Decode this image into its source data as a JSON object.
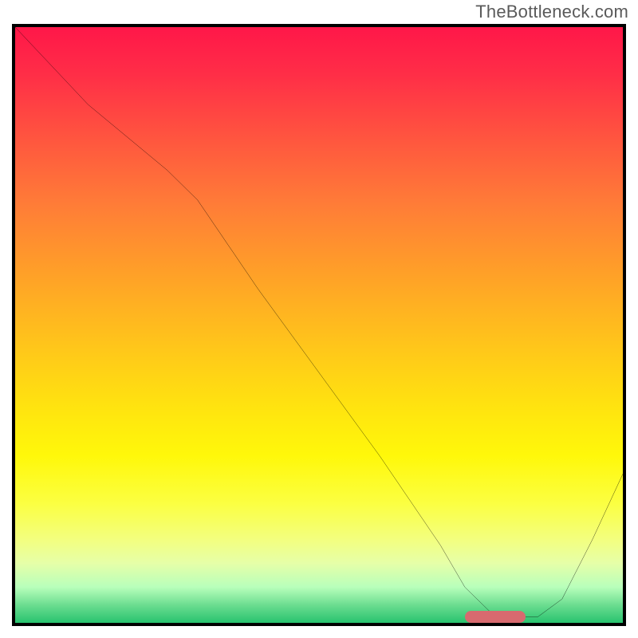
{
  "watermark": "TheBottleneck.com",
  "chart_data": {
    "type": "line",
    "title": "",
    "xlabel": "",
    "ylabel": "",
    "xlim": [
      0,
      100
    ],
    "ylim": [
      0,
      100
    ],
    "grid": false,
    "series": [
      {
        "name": "curve",
        "x": [
          0,
          12,
          25,
          30,
          40,
          50,
          60,
          70,
          74,
          78,
          82,
          86,
          90,
          95,
          100
        ],
        "values": [
          100,
          87,
          76,
          71,
          56,
          42,
          28,
          13,
          6,
          2,
          1,
          1,
          4,
          14,
          25
        ]
      }
    ],
    "marker": {
      "x_start": 74,
      "x_end": 84,
      "y": 1,
      "color": "#d86a6f"
    },
    "background_gradient": {
      "top": "#ff1749",
      "mid": "#ffe40f",
      "bottom": "#28c36f"
    }
  }
}
